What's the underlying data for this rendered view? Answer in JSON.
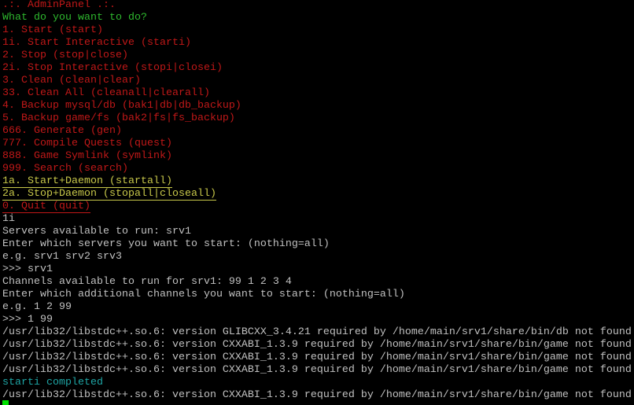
{
  "colors": {
    "menu": "#c01818",
    "prompt": "#2eb82e",
    "daemon": "#c8c84a",
    "output": "#c0c0c0",
    "success": "#1ea5a5",
    "cursor": "#00e000"
  },
  "lines": [
    {
      "text": ".:. AdminPanel .:.",
      "style": "red"
    },
    {
      "text": "What do you want to do?",
      "style": "green"
    },
    {
      "text": "1. Start (start)",
      "style": "red"
    },
    {
      "text": "1i. Start Interactive (starti)",
      "style": "red"
    },
    {
      "text": "2. Stop (stop|close)",
      "style": "red"
    },
    {
      "text": "2i. Stop Interactive (stopi|closei)",
      "style": "red"
    },
    {
      "text": "3. Clean (clean|clear)",
      "style": "red"
    },
    {
      "text": "33. Clean All (cleanall|clearall)",
      "style": "red"
    },
    {
      "text": "4. Backup mysql/db (bak1|db|db_backup)",
      "style": "red"
    },
    {
      "text": "5. Backup game/fs (bak2|fs|fs_backup)",
      "style": "red"
    },
    {
      "text": "666. Generate (gen)",
      "style": "red"
    },
    {
      "text": "777. Compile Quests (quest)",
      "style": "red"
    },
    {
      "text": "888. Game Symlink (symlink)",
      "style": "red"
    },
    {
      "text": "999. Search (search)",
      "style": "red"
    },
    {
      "text": "1a. Start+Daemon (startall)",
      "style": "yellow ul"
    },
    {
      "text": "2a. Stop+Daemon (stopall|closeall)",
      "style": "yellow ul"
    },
    {
      "text": "0. Quit (quit)",
      "style": "red ul"
    },
    {
      "text": "1i",
      "style": "gray"
    },
    {
      "text": "Servers available to run: srv1",
      "style": "gray"
    },
    {
      "text": "Enter which servers you want to start: (nothing=all)",
      "style": "gray"
    },
    {
      "text": "e.g. srv1 srv2 srv3",
      "style": "gray"
    },
    {
      "text": ">>> srv1",
      "style": "gray"
    },
    {
      "text": "Channels available to run for srv1: 99 1 2 3 4",
      "style": "gray"
    },
    {
      "text": "Enter which additional channels you want to start: (nothing=all)",
      "style": "gray"
    },
    {
      "text": "e.g. 1 2 99",
      "style": "gray"
    },
    {
      "text": ">>> 1 99",
      "style": "gray"
    },
    {
      "text": "/usr/lib32/libstdc++.so.6: version GLIBCXX_3.4.21 required by /home/main/srv1/share/bin/db not found",
      "style": "gray"
    },
    {
      "text": "/usr/lib32/libstdc++.so.6: version CXXABI_1.3.9 required by /home/main/srv1/share/bin/game not found",
      "style": "gray"
    },
    {
      "text": "/usr/lib32/libstdc++.so.6: version CXXABI_1.3.9 required by /home/main/srv1/share/bin/game not found",
      "style": "gray"
    },
    {
      "text": "/usr/lib32/libstdc++.so.6: version CXXABI_1.3.9 required by /home/main/srv1/share/bin/game not found",
      "style": "gray"
    },
    {
      "text": "starti completed",
      "style": "cyan"
    },
    {
      "text": "/usr/lib32/libstdc++.so.6: version CXXABI_1.3.9 required by /home/main/srv1/share/bin/game not found",
      "style": "gray"
    }
  ]
}
